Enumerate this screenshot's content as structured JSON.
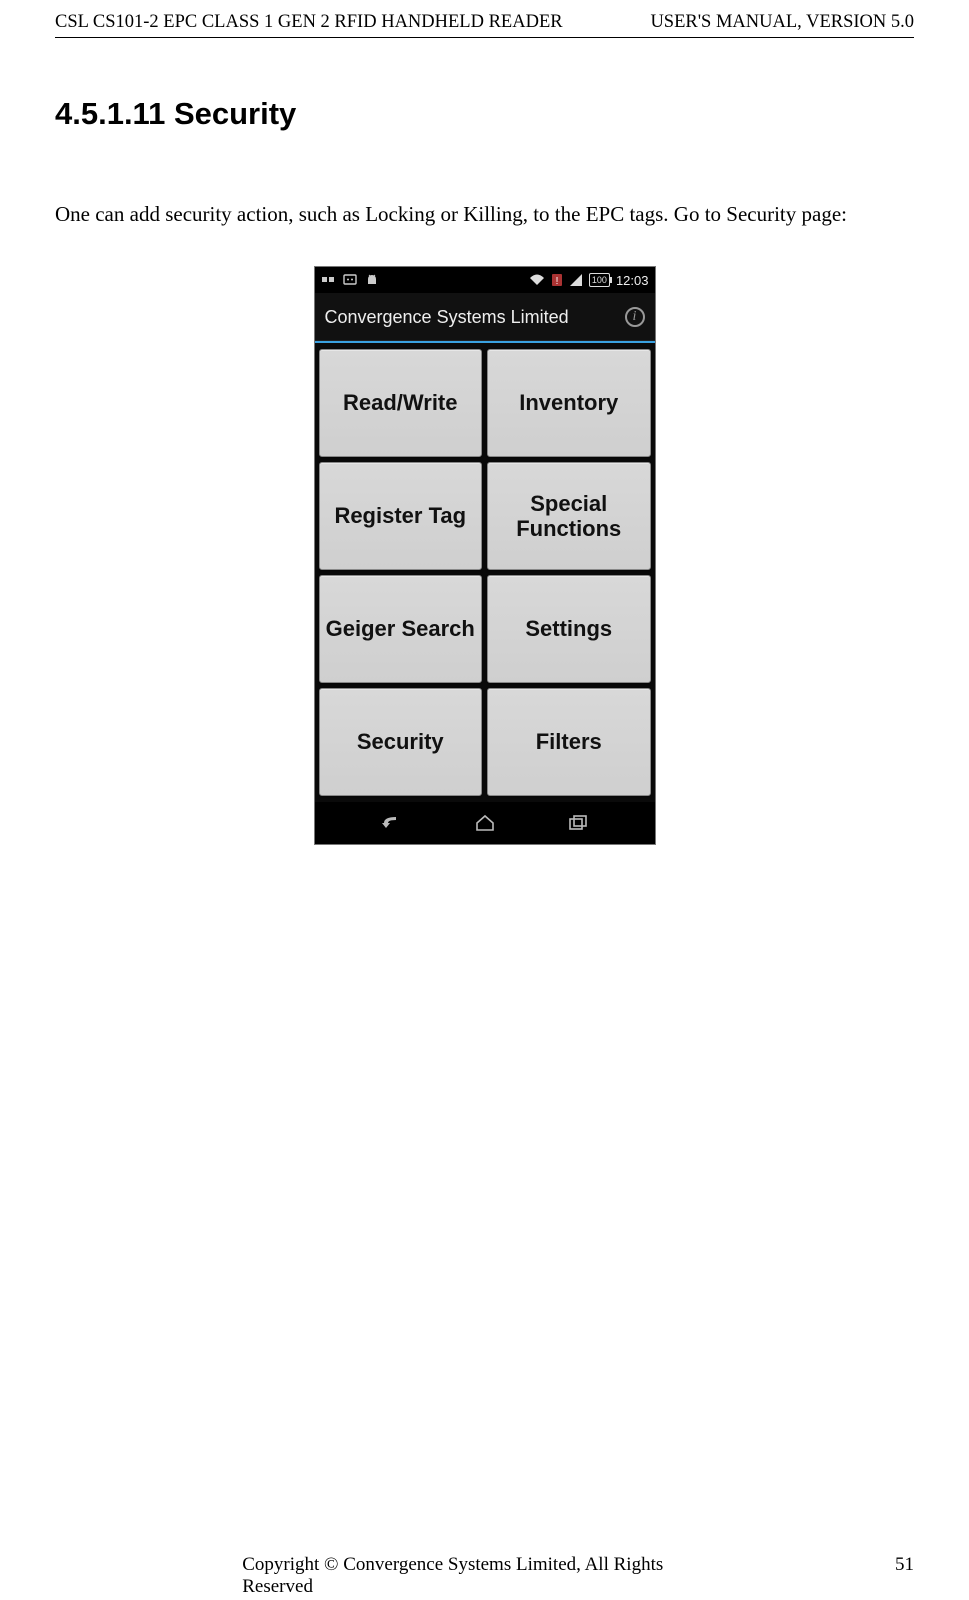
{
  "header": {
    "left": "CSL CS101-2 EPC CLASS 1 GEN 2 RFID HANDHELD READER",
    "right": "USER'S  MANUAL,  VERSION  5.0"
  },
  "section": {
    "heading": "4.5.1.11 Security",
    "body": "One can add security action, such as Locking or Killing, to the EPC tags.   Go to Security page:"
  },
  "screenshot": {
    "status_bar": {
      "left_icons": [
        "two-dots-icon",
        "dialog-icon",
        "android-icon"
      ],
      "right": {
        "wifi": true,
        "sim_error": true,
        "signal": true,
        "battery_text": "100",
        "time": "12:03"
      }
    },
    "title_bar": {
      "title": "Convergence Systems Limited",
      "info_icon": "i"
    },
    "buttons": [
      "Read/Write",
      "Inventory",
      "Register Tag",
      "Special Functions",
      "Geiger Search",
      "Settings",
      "Security",
      "Filters"
    ],
    "nav_icons": [
      "back-icon",
      "home-icon",
      "recent-icon"
    ]
  },
  "footer": {
    "text": "Copyright © Convergence Systems Limited, All Rights Reserved",
    "page": "51"
  }
}
